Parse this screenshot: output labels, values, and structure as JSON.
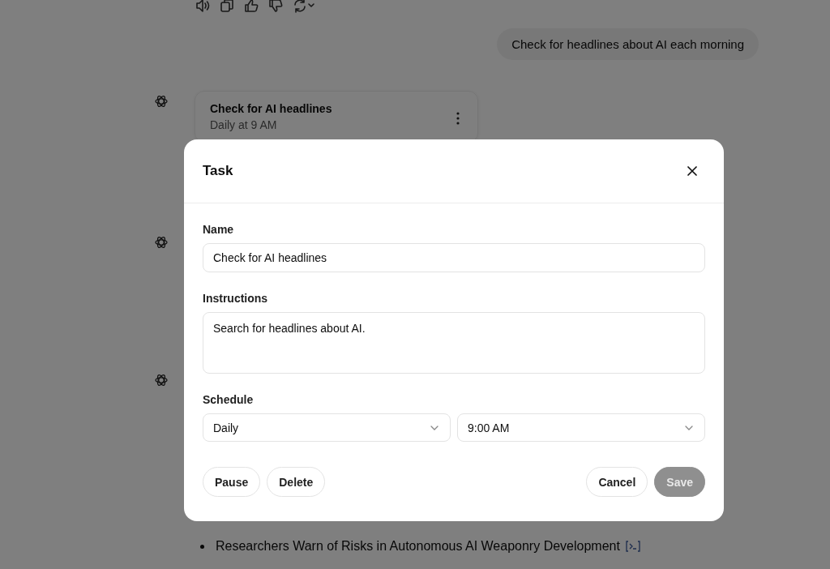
{
  "user_message": "Check for headlines about AI each morning",
  "task_card": {
    "title": "Check for AI headlines",
    "schedule": "Daily at 9 AM"
  },
  "bullets": [
    "Researchers Warn of Risks in Autonomous AI Weaponry Development"
  ],
  "dialog": {
    "title": "Task",
    "fields": [
      {
        "kind": "input",
        "label": "Name",
        "value": "Check for AI headlines"
      },
      {
        "kind": "textarea",
        "label": "Instructions",
        "value": "Search for headlines about AI."
      },
      {
        "kind": "selects",
        "label": "Schedule",
        "options": [
          "Daily",
          "9:00 AM"
        ]
      }
    ],
    "left_buttons": [
      {
        "label": "Pause",
        "disabled": false
      },
      {
        "label": "Delete",
        "disabled": false
      }
    ],
    "right_buttons": [
      {
        "label": "Cancel",
        "kind": "secondary",
        "disabled": false
      },
      {
        "label": "Save",
        "kind": "primary",
        "disabled": true
      }
    ]
  }
}
